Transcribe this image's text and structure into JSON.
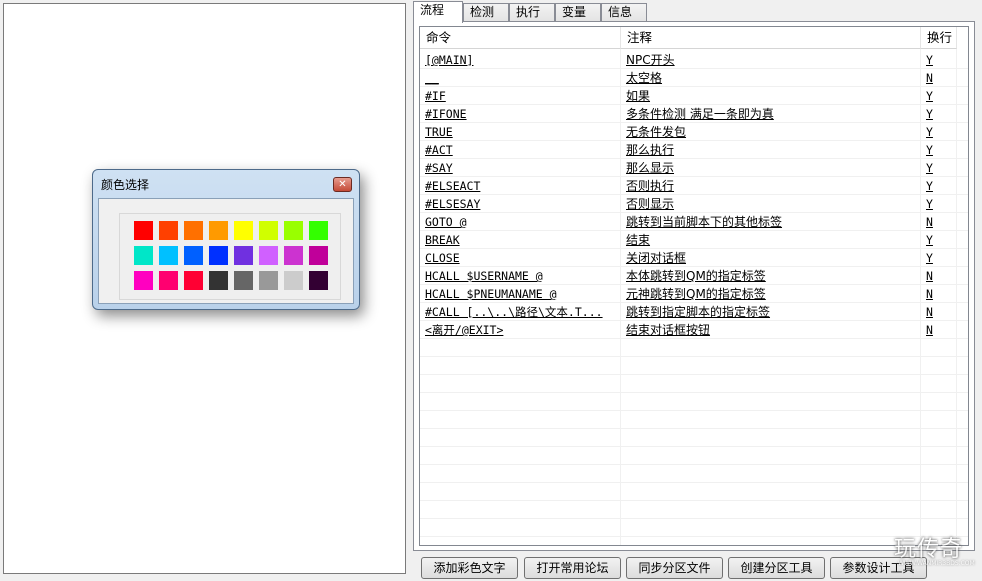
{
  "tabs": [
    {
      "label": "流程",
      "active": true
    },
    {
      "label": "检测",
      "active": false
    },
    {
      "label": "执行",
      "active": false
    },
    {
      "label": "变量",
      "active": false
    },
    {
      "label": "信息",
      "active": false
    }
  ],
  "color_dialog": {
    "title": "颜色选择",
    "close_icon": "close-icon",
    "swatches": [
      [
        "#ff0000",
        "#ff4000",
        "#ff7000",
        "#ff9a00",
        "#ffff00",
        "#d0ff00",
        "#99ff00",
        "#33ff00"
      ],
      [
        "#00e6c8",
        "#00c0ff",
        "#0060ff",
        "#0030ff",
        "#7030e0",
        "#d060ff",
        "#cc33d0",
        "#c0009a"
      ],
      [
        "#ff00c0",
        "#ff0070",
        "#ff0033",
        "#333333",
        "#666666",
        "#999999",
        "#cccccc",
        "#330033"
      ]
    ]
  },
  "list": {
    "columns": [
      "命令",
      "注释",
      "换行"
    ],
    "rows": [
      {
        "cmd": "[@MAIN]",
        "note": "NPC开头",
        "wrap": "Y"
      },
      {
        "cmd": "__",
        "note": "太空格",
        "wrap": "N"
      },
      {
        "cmd": "#IF",
        "note": "如果",
        "wrap": "Y"
      },
      {
        "cmd": "#IFONE",
        "note": "多条件检测 满足一条即为真",
        "wrap": "Y"
      },
      {
        "cmd": "TRUE",
        "note": "无条件发包",
        "wrap": "Y"
      },
      {
        "cmd": "#ACT",
        "note": "那么执行",
        "wrap": "Y"
      },
      {
        "cmd": "#SAY",
        "note": "那么显示",
        "wrap": "Y"
      },
      {
        "cmd": "#ELSEACT",
        "note": "否则执行",
        "wrap": "Y"
      },
      {
        "cmd": "#ELSESAY",
        "note": "否则显示",
        "wrap": "Y"
      },
      {
        "cmd": "GOTO @",
        "note": "跳转到当前脚本下的其他标签",
        "wrap": "N"
      },
      {
        "cmd": "BREAK",
        "note": "结束",
        "wrap": "Y"
      },
      {
        "cmd": "CLOSE",
        "note": "关闭对话框",
        "wrap": "Y"
      },
      {
        "cmd": "HCALL $USERNAME @",
        "note": "本体跳转到QM的指定标签",
        "wrap": "N"
      },
      {
        "cmd": "HCALL $PNEUMANAME @",
        "note": "元神跳转到QM的指定标签",
        "wrap": "N"
      },
      {
        "cmd": "#CALL [..\\..\\路径\\文本.T...",
        "note": "跳转到指定脚本的指定标签",
        "wrap": "N"
      },
      {
        "cmd": "<离开/@EXIT>",
        "note": "结束对话框按钮",
        "wrap": "N"
      }
    ]
  },
  "buttons": [
    "添加彩色文字",
    "打开常用论坛",
    "同步分区文件",
    "创建分区工具",
    "参数设计工具"
  ],
  "watermark": {
    "text": "玩传奇",
    "url": "WWW.WANMIR3BDS.COM"
  }
}
